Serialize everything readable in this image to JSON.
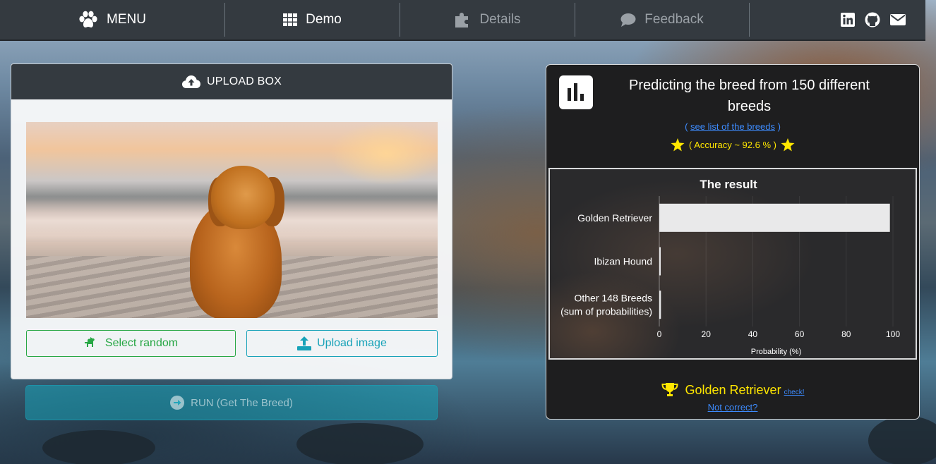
{
  "navbar": {
    "brand_label": "MENU",
    "tabs": [
      {
        "label": "Demo",
        "icon": "grid-icon",
        "active": true
      },
      {
        "label": "Details",
        "icon": "puzzle-icon",
        "active": false
      },
      {
        "label": "Feedback",
        "icon": "comment-icon",
        "active": false
      }
    ],
    "social": [
      "linkedin-icon",
      "github-icon",
      "envelope-icon"
    ]
  },
  "upload": {
    "header_label": "UPLOAD BOX",
    "random_button": "Select random",
    "upload_button": "Upload image",
    "run_button": "RUN (Get The Breed)"
  },
  "result": {
    "title": "Predicting the breed from 150 different breeds",
    "breeds_link_prefix": "( ",
    "breeds_link_text": "see list of the breeds",
    "breeds_link_suffix": " )",
    "accuracy": "( Accuracy ~ 92.6 % )",
    "winner": "Golden Retriever",
    "check_link": "check!",
    "not_correct": "Not correct?"
  },
  "colors": {
    "navbar": "#343a40",
    "success": "#28a745",
    "info": "#17a2b8",
    "highlight": "#ffe600",
    "link": "#3d8bfd"
  },
  "chart_data": {
    "type": "bar",
    "orientation": "horizontal",
    "title": "The result",
    "categories": [
      "Golden Retriever",
      "Ibizan Hound",
      "Other 148 Breeds\n(sum of probabilities)"
    ],
    "values": [
      98.7,
      0.6,
      0.7
    ],
    "xlabel": "Probability (%)",
    "ylabel": "",
    "xlim": [
      0,
      100
    ],
    "xticks": [
      0,
      20,
      40,
      60,
      80,
      100
    ],
    "grid": true
  }
}
